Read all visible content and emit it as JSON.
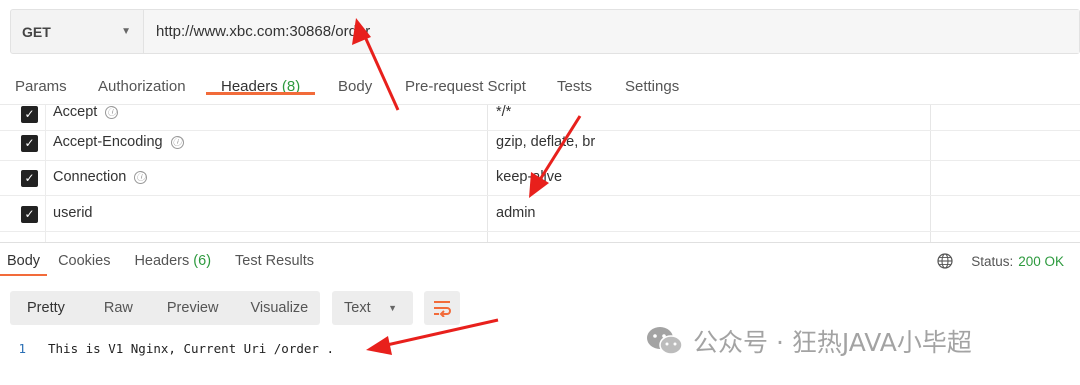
{
  "request": {
    "method": "GET",
    "url": "http://www.xbc.com:30868/order"
  },
  "request_tabs": [
    {
      "label": "Params"
    },
    {
      "label": "Authorization"
    },
    {
      "label": "Headers",
      "count": "(8)",
      "active": true
    },
    {
      "label": "Body"
    },
    {
      "label": "Pre-request Script"
    },
    {
      "label": "Tests"
    },
    {
      "label": "Settings"
    }
  ],
  "headers": [
    {
      "key": "Accept",
      "value": "*/*",
      "checked": true
    },
    {
      "key": "Accept-Encoding",
      "value": "gzip, deflate, br",
      "checked": true
    },
    {
      "key": "Connection",
      "value": "keep-alive",
      "checked": true
    },
    {
      "key": "userid",
      "value": "admin",
      "checked": true
    }
  ],
  "info_icon": "ⓘ",
  "response_tabs": [
    {
      "label": "Body",
      "active": true
    },
    {
      "label": "Cookies"
    },
    {
      "label": "Headers",
      "count": "(6)"
    },
    {
      "label": "Test Results"
    }
  ],
  "status": {
    "label": "Status:",
    "value": "200 OK"
  },
  "view_modes": [
    "Pretty",
    "Raw",
    "Preview",
    "Visualize"
  ],
  "format": "Text",
  "response_body": {
    "line_number": "1",
    "text": "This is V1 Nginx, Current Uri /order ."
  },
  "watermark": "公众号 · 狂热JAVA小毕超",
  "colors": {
    "accent": "#f26b3a",
    "status_ok": "#2d9a3e",
    "arrow": "#e8201c"
  }
}
